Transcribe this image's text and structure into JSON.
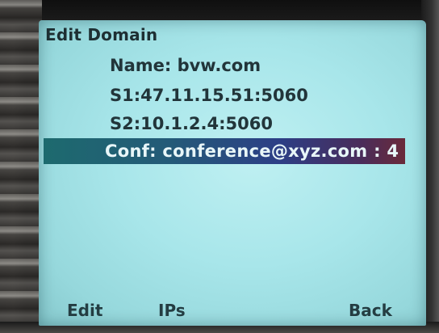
{
  "screen": {
    "title": "Edit Domain"
  },
  "domain": {
    "name_line": "Name: bvw.com",
    "server1_line": "S1:47.11.15.51:5060",
    "server2_line": "S2:10.1.2.4:5060",
    "conf_line": "Conf: conference@xyz.com : 4"
  },
  "softkeys": {
    "left": "Edit",
    "middle": "IPs",
    "right": "Back"
  },
  "colors": {
    "lcd_background": "#a8e6ea",
    "selection_start": "#1d6a6e",
    "selection_end": "#6a2a3a"
  }
}
